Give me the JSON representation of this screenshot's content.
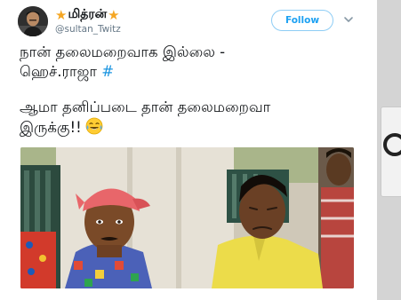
{
  "tweet": {
    "display_name": "மித்ரன்",
    "handle": "@sultan_Twitz",
    "follow_label": "Follow",
    "lines": [
      "நான் தலைமறைவாக இல்லை -",
      "ஹெச்.ராஜா",
      "ஆமா தனிப்படை தான் தலைமறைவா",
      "இருக்கு!!"
    ],
    "hashtag": "#",
    "emoji": "😂",
    "timestamp": ""
  },
  "icons": {
    "name_decoration": "star-icon",
    "menu": "chevron-down-icon",
    "avatar": "avatar-photo"
  },
  "colors": {
    "follow_blue": "#1da1f2",
    "hashtag_blue": "#1b95e0",
    "handle_gray": "#657786",
    "star_gold": "#f5a623"
  }
}
